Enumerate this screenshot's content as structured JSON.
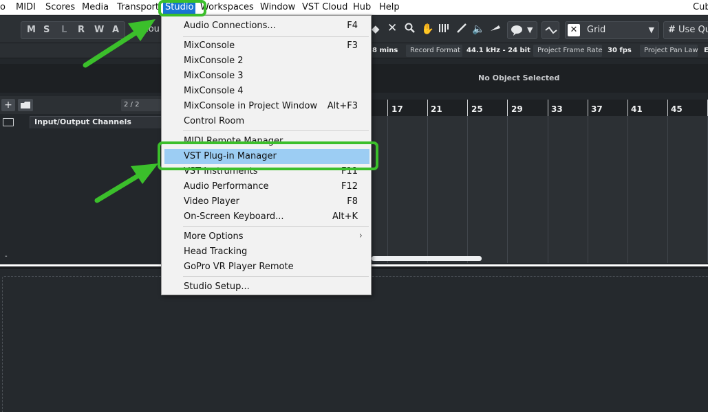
{
  "menubar": {
    "items": [
      "o",
      "MIDI",
      "Scores",
      "Media",
      "Transport",
      "Studio",
      "Workspaces",
      "Window",
      "VST Cloud",
      "Hub",
      "Help"
    ],
    "active": "Studio",
    "app_title_fragment": "Cub"
  },
  "toolbar": {
    "msl_letters": [
      "M",
      "S",
      "L",
      "R",
      "W",
      "A"
    ],
    "touch_fragment": "Tou",
    "grid_label": "Grid",
    "grid_icon": "grid-snap-icon",
    "use_quantize": "Use Qu",
    "tool_icons": [
      "eraser-icon",
      "mute-x-icon",
      "zoom-icon",
      "hand-icon",
      "split-icon",
      "draw-icon",
      "speaker-icon",
      "comp-icon",
      "chord-icon",
      "snap-icon"
    ]
  },
  "statusbar": {
    "time_fragment": "8 mins",
    "record_format_label": "Record Format",
    "record_format_value": "44.1 kHz - 24 bit",
    "frame_rate_label": "Project Frame Rate",
    "frame_rate_value": "30 fps",
    "pan_law_label": "Project Pan Law",
    "pan_law_fragment": "E"
  },
  "infoline": {
    "message": "No Object Selected"
  },
  "tracklist": {
    "add_glyph": "+",
    "count": "2 / 2",
    "track_name": "Input/Output Channels",
    "bottom_glyph": "-"
  },
  "ruler": {
    "bars": [
      "17",
      "21",
      "25",
      "29",
      "33",
      "37",
      "41",
      "45"
    ]
  },
  "studio_menu": {
    "items": [
      {
        "label": "Audio Connections...",
        "shortcut": "F4"
      },
      {
        "label": "MixConsole",
        "shortcut": "F3"
      },
      {
        "label": "MixConsole 2",
        "shortcut": ""
      },
      {
        "label": "MixConsole 3",
        "shortcut": ""
      },
      {
        "label": "MixConsole 4",
        "shortcut": ""
      },
      {
        "label": "MixConsole in Project Window",
        "shortcut": "Alt+F3"
      },
      {
        "label": "Control Room",
        "shortcut": ""
      },
      {
        "label": "MIDI Remote Manager",
        "shortcut": ""
      },
      {
        "label": "VST Plug-in Manager",
        "shortcut": ""
      },
      {
        "label": "VST Instruments",
        "shortcut": "F11"
      },
      {
        "label": "Audio Performance",
        "shortcut": "F12"
      },
      {
        "label": "Video Player",
        "shortcut": "F8"
      },
      {
        "label": "On-Screen Keyboard...",
        "shortcut": "Alt+K"
      },
      {
        "label": "More Options",
        "shortcut": "›"
      },
      {
        "label": "Head Tracking",
        "shortcut": ""
      },
      {
        "label": "GoPro VR Player Remote",
        "shortcut": ""
      },
      {
        "label": "Studio Setup...",
        "shortcut": ""
      }
    ],
    "highlighted": "VST Plug-in Manager"
  },
  "colors": {
    "highlight_green": "#3bbf2b",
    "menu_selected": "#1976d2",
    "menu_hover": "#9ccdf3"
  }
}
